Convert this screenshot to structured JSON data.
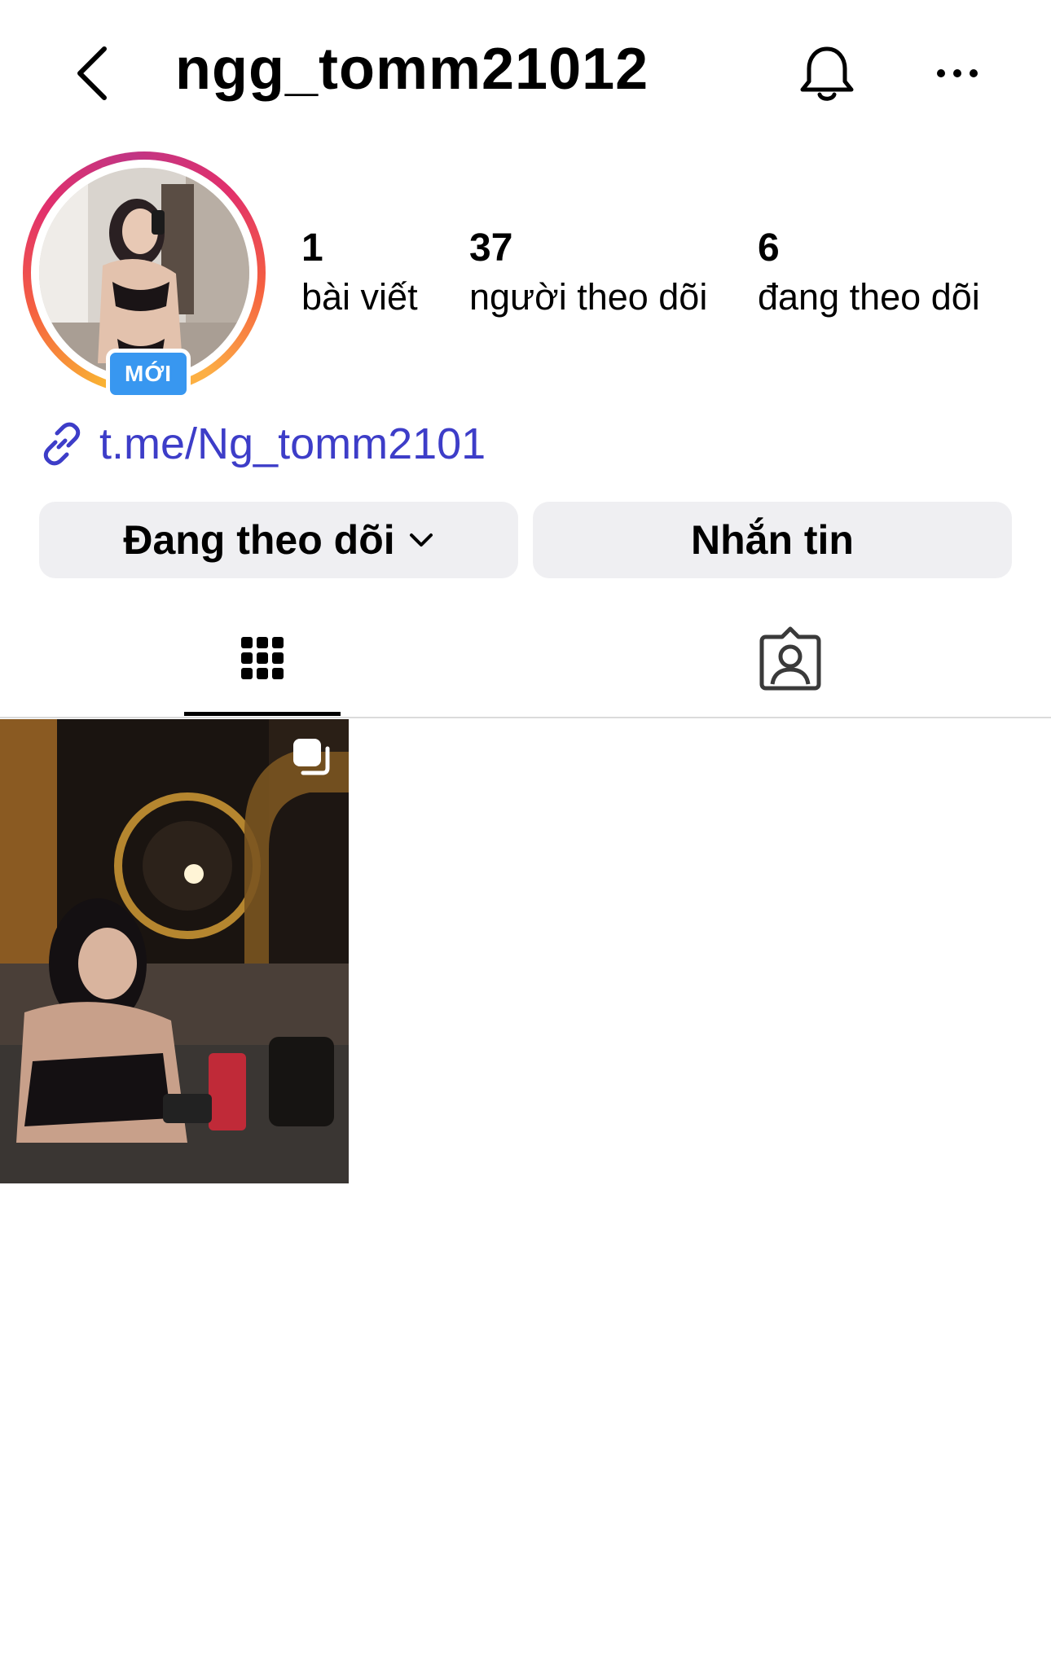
{
  "header": {
    "username": "ngg_tomm21012",
    "back_icon": "chevron-left-icon",
    "bell_icon": "bell-icon",
    "more_icon": "ellipsis-icon"
  },
  "profile": {
    "avatar_badge": "MỚI",
    "stats": [
      {
        "value": "1",
        "label": "bài viết"
      },
      {
        "value": "37",
        "label": "người theo dõi"
      },
      {
        "value": "6",
        "label": "đang theo dõi"
      }
    ],
    "link": "t.me/Ng_tomm2101",
    "link_color": "#3d3dc8"
  },
  "actions": {
    "following_label": "Đang theo dõi",
    "message_label": "Nhắn tin"
  },
  "tabs": [
    {
      "icon": "grid-icon",
      "active": true
    },
    {
      "icon": "tagged-person-icon",
      "active": false
    }
  ],
  "posts": [
    {
      "type": "multi",
      "icon": "carousel-icon"
    }
  ]
}
